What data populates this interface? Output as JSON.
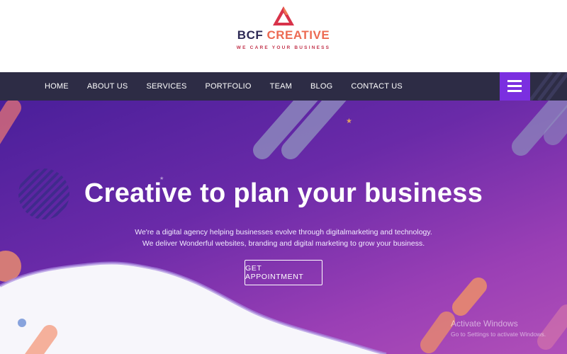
{
  "brand": {
    "name_part1": "BCF",
    "name_part2": "CREATIVE",
    "tagline": "WE CARE YOUR BUSINESS",
    "logo_icon": "triangle-logo-icon"
  },
  "nav": {
    "items": [
      "HOME",
      "ABOUT US",
      "SERVICES",
      "PORTFOLIO",
      "TEAM",
      "BLOG",
      "CONTACT US"
    ],
    "menu_icon": "hamburger-menu-icon"
  },
  "hero": {
    "title": "Creative to plan your business",
    "subtitle_line1": "We're a digital agency helping businesses evolve through digitalmarketing and technology.",
    "subtitle_line2": "We deliver Wonderful websites, branding and digital marketing to grow your business.",
    "cta_label": "GET APPOINTMENT"
  },
  "watermark": {
    "title": "Activate Windows",
    "subtitle": "Go to Settings to activate Windows."
  },
  "colors": {
    "navbar": "#2d2c45",
    "menu_button": "#7b2fe0",
    "brand_accent": "#ec6a52",
    "hero_start": "#4a1f9a",
    "hero_end": "#b04fb8"
  }
}
